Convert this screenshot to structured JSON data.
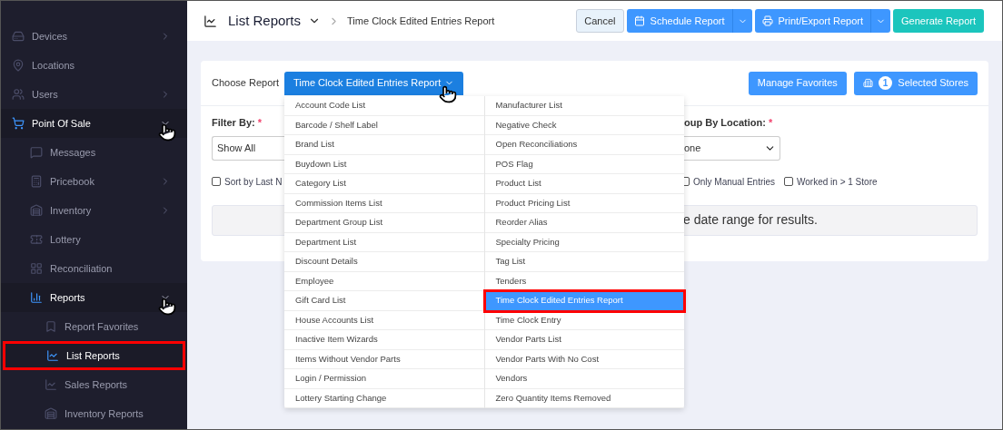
{
  "sidebar": {
    "items": [
      {
        "label": "Devices",
        "kind": "devices",
        "expandable": true,
        "expanded": false,
        "selected": false,
        "highlighted": false
      },
      {
        "label": "Locations",
        "kind": "pin",
        "expandable": false,
        "expanded": false,
        "selected": false,
        "highlighted": false
      },
      {
        "label": "Users",
        "kind": "users",
        "expandable": true,
        "expanded": false,
        "selected": false,
        "highlighted": false
      },
      {
        "label": "Point Of Sale",
        "kind": "cart",
        "expandable": true,
        "expanded": true,
        "selected": true,
        "highlighted": false,
        "children": [
          {
            "label": "Messages",
            "kind": "message",
            "expandable": false,
            "expanded": false,
            "selected": false,
            "highlighted": false
          },
          {
            "label": "Pricebook",
            "kind": "calc",
            "expandable": true,
            "expanded": false,
            "selected": false,
            "highlighted": false
          },
          {
            "label": "Inventory",
            "kind": "inventory",
            "expandable": true,
            "expanded": false,
            "selected": false,
            "highlighted": false
          },
          {
            "label": "Lottery",
            "kind": "ticket",
            "expandable": false,
            "expanded": false,
            "selected": false,
            "highlighted": false
          },
          {
            "label": "Reconciliation",
            "kind": "grid",
            "expandable": false,
            "expanded": false,
            "selected": false,
            "highlighted": false
          },
          {
            "label": "Reports",
            "kind": "bars",
            "expandable": true,
            "expanded": true,
            "selected": true,
            "highlighted": false,
            "children": [
              {
                "label": "Report Favorites",
                "kind": "bookmark",
                "expandable": false,
                "expanded": false,
                "selected": false,
                "highlighted": false
              },
              {
                "label": "List Reports",
                "kind": "chart",
                "expandable": false,
                "expanded": false,
                "selected": true,
                "highlighted": true
              },
              {
                "label": "Sales Reports",
                "kind": "chart",
                "expandable": false,
                "expanded": false,
                "selected": false,
                "highlighted": false
              },
              {
                "label": "Inventory Reports",
                "kind": "inventory",
                "expandable": false,
                "expanded": false,
                "selected": false,
                "highlighted": false
              }
            ]
          }
        ]
      }
    ]
  },
  "header": {
    "title": "List Reports",
    "breadcrumb": "Time Clock Edited Entries Report",
    "buttons": [
      {
        "label": "Cancel",
        "kind": "plain"
      },
      {
        "label": "Schedule Report",
        "kind": "split"
      },
      {
        "label": "Print/Export Report",
        "kind": "split"
      },
      {
        "label": "Generate Report",
        "kind": "success"
      }
    ]
  },
  "card": {
    "choose_label": "Choose Report",
    "selected_report": "Time Clock Edited Entries Report",
    "manage_favorites": "Manage Favorites",
    "store_count": "1",
    "selected_stores": "Selected Stores",
    "filter_label": "Filter By:",
    "filter_required": "*",
    "filter_value": "Show All",
    "sort_checkbox": {
      "label": "Sort by Last N",
      "checked": false
    },
    "group_label": "oup By Location:",
    "group_required": "*",
    "group_value": "one",
    "checkboxes": [
      {
        "label": "Only Manual Entries",
        "checked": false
      },
      {
        "label": "Worked in > 1 Store",
        "checked": false
      }
    ],
    "message": "e date range for results."
  },
  "report_menu": {
    "columns": [
      [
        {
          "label": "Account Code List",
          "selected": false
        },
        {
          "label": "Barcode / Shelf Label",
          "selected": false
        },
        {
          "label": "Brand List",
          "selected": false
        },
        {
          "label": "Buydown List",
          "selected": false
        },
        {
          "label": "Category List",
          "selected": false
        },
        {
          "label": "Commission Items List",
          "selected": false
        },
        {
          "label": "Department Group List",
          "selected": false
        },
        {
          "label": "Department List",
          "selected": false
        },
        {
          "label": "Discount Details",
          "selected": false
        },
        {
          "label": "Employee",
          "selected": false
        },
        {
          "label": "Gift Card List",
          "selected": false
        },
        {
          "label": "House Accounts List",
          "selected": false
        },
        {
          "label": "Inactive Item Wizards",
          "selected": false
        },
        {
          "label": "Items Without Vendor Parts",
          "selected": false
        },
        {
          "label": "Login / Permission",
          "selected": false
        },
        {
          "label": "Lottery Starting Change",
          "selected": false
        }
      ],
      [
        {
          "label": "Manufacturer List",
          "selected": false
        },
        {
          "label": "Negative Check",
          "selected": false
        },
        {
          "label": "Open Reconciliations",
          "selected": false
        },
        {
          "label": "POS Flag",
          "selected": false
        },
        {
          "label": "Product List",
          "selected": false
        },
        {
          "label": "Product Pricing List",
          "selected": false
        },
        {
          "label": "Reorder Alias",
          "selected": false
        },
        {
          "label": "Specialty Pricing",
          "selected": false
        },
        {
          "label": "Tag List",
          "selected": false
        },
        {
          "label": "Tenders",
          "selected": false
        },
        {
          "label": "Time Clock Edited Entries Report",
          "selected": true
        },
        {
          "label": "Time Clock Entry",
          "selected": false
        },
        {
          "label": "Vendor Parts List",
          "selected": false
        },
        {
          "label": "Vendor Parts With No Cost",
          "selected": false
        },
        {
          "label": "Vendors",
          "selected": false
        },
        {
          "label": "Zero Quantity Items Removed",
          "selected": false
        }
      ]
    ]
  }
}
